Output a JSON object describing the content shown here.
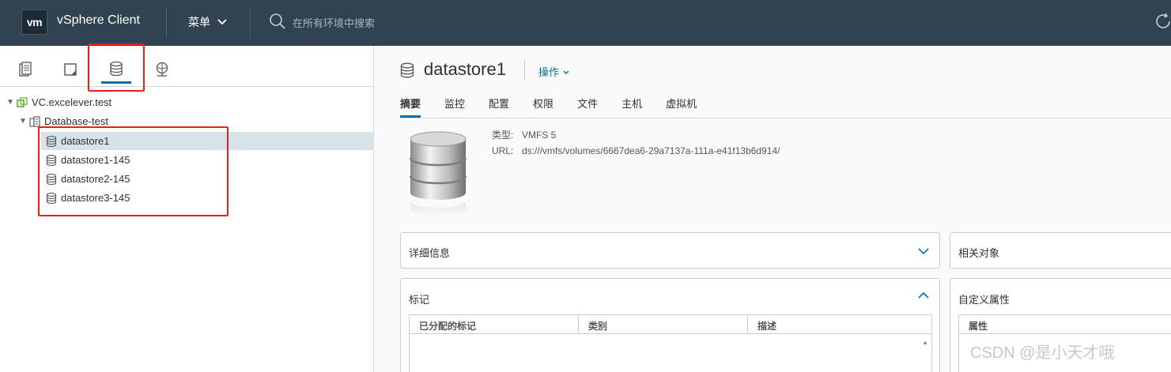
{
  "header": {
    "logo_text": "vm",
    "app_title": "vSphere Client",
    "menu_label": "菜单",
    "search_placeholder": "在所有环境中搜索"
  },
  "left_panel": {
    "tabs": [
      {
        "name": "hosts-and-clusters",
        "icon": "hosts-clusters-icon"
      },
      {
        "name": "vms-and-templates",
        "icon": "vm-template-icon"
      },
      {
        "name": "storage",
        "icon": "datastore-icon",
        "active": true
      },
      {
        "name": "networking",
        "icon": "network-icon"
      }
    ],
    "tree": {
      "vcenter": "VC.excelever.test",
      "datacenter": "Database-test",
      "datastores": [
        "datastore1",
        "datastore1-145",
        "datastore2-145",
        "datastore3-145"
      ],
      "selected": "datastore1"
    }
  },
  "object": {
    "title": "datastore1",
    "actions_label": "操作",
    "tabs": [
      "摘要",
      "监控",
      "配置",
      "权限",
      "文件",
      "主机",
      "虚拟机"
    ],
    "active_tab": "摘要",
    "type_label": "类型:",
    "type_value": "VMFS 5",
    "url_label": "URL:",
    "url_value": "ds:///vmfs/volumes/6667dea6-29a7137a-111a-e41f13b6d914/"
  },
  "cards": {
    "details": {
      "title": "详细信息"
    },
    "related": {
      "title": "相关对象"
    },
    "tags": {
      "title": "标记",
      "columns": [
        "已分配的标记",
        "类别",
        "描述"
      ]
    },
    "custom_attributes": {
      "title": "自定义属性",
      "columns": [
        "属性"
      ]
    }
  },
  "watermark": "CSDN @是小天才哦",
  "colors": {
    "header_bg": "#314351",
    "accent": "#0072a3",
    "selection": "#d8e3e9",
    "highlight_box": "#e8201c"
  }
}
